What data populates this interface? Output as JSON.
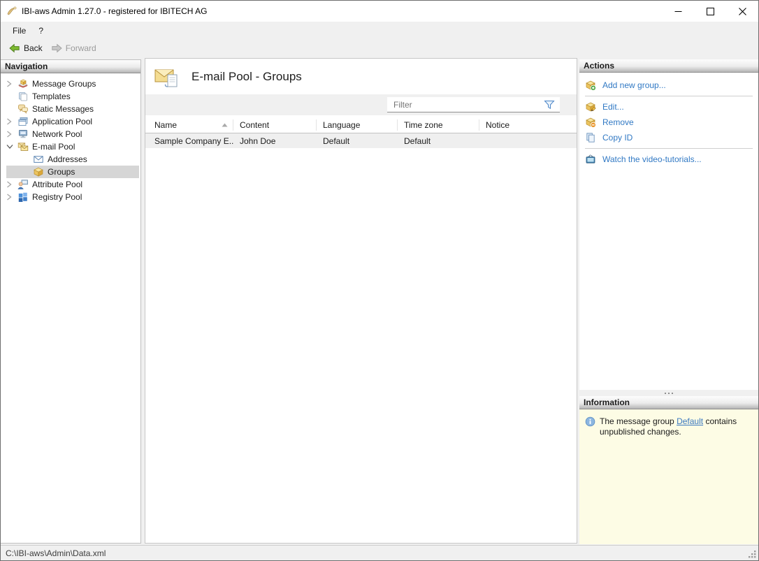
{
  "window": {
    "title": "IBI-aws Admin 1.27.0 - registered for IBITECH AG",
    "controls": [
      "minimize",
      "maximize",
      "close"
    ]
  },
  "menubar": {
    "file": "File",
    "help": "?"
  },
  "toolbar": {
    "back": "Back",
    "forward": "Forward",
    "forward_enabled": false
  },
  "navigation": {
    "header": "Navigation",
    "items": [
      {
        "label": "Message Groups",
        "icon": "message-groups-icon",
        "chevron": "collapsed",
        "level": 0,
        "selected": false
      },
      {
        "label": "Templates",
        "icon": "templates-icon",
        "chevron": "none",
        "level": 0,
        "selected": false
      },
      {
        "label": "Static Messages",
        "icon": "static-messages-icon",
        "chevron": "none",
        "level": 0,
        "selected": false
      },
      {
        "label": "Application Pool",
        "icon": "application-pool-icon",
        "chevron": "collapsed",
        "level": 0,
        "selected": false
      },
      {
        "label": "Network Pool",
        "icon": "network-pool-icon",
        "chevron": "collapsed",
        "level": 0,
        "selected": false
      },
      {
        "label": "E-mail Pool",
        "icon": "email-pool-icon",
        "chevron": "expanded",
        "level": 0,
        "selected": false
      },
      {
        "label": "Addresses",
        "icon": "addresses-icon",
        "chevron": "none",
        "level": 1,
        "selected": false
      },
      {
        "label": "Groups",
        "icon": "groups-icon",
        "chevron": "none",
        "level": 1,
        "selected": true
      },
      {
        "label": "Attribute Pool",
        "icon": "attribute-pool-icon",
        "chevron": "collapsed",
        "level": 0,
        "selected": false
      },
      {
        "label": "Registry Pool",
        "icon": "registry-pool-icon",
        "chevron": "collapsed",
        "level": 0,
        "selected": false
      }
    ]
  },
  "main": {
    "title": "E-mail Pool - Groups",
    "filter": {
      "placeholder": "Filter"
    },
    "table": {
      "columns": [
        "Name",
        "Content",
        "Language",
        "Time zone",
        "Notice"
      ],
      "sort": {
        "column": "Name",
        "direction": "ascending"
      },
      "rows": [
        {
          "name": "Sample Company E...",
          "content": "John Doe",
          "language": "Default",
          "timezone": "Default",
          "notice": ""
        }
      ]
    }
  },
  "actions": {
    "header": "Actions",
    "add": "Add new group...",
    "edit": "Edit...",
    "remove": "Remove",
    "copy": "Copy ID",
    "tutorials": "Watch the video-tutorials..."
  },
  "information": {
    "header": "Information",
    "text_before": "The message group",
    "link": "Default",
    "text_after": "contains unpublished changes."
  },
  "statusbar": {
    "path": "C:\\IBI-aws\\Admin\\Data.xml"
  },
  "colors": {
    "action_link": "#3179c4",
    "info_link": "#3b78bf",
    "info_background": "#fdfce5",
    "selection_background": "#d6d6d6",
    "back_arrow_green": "#7cb82f"
  }
}
